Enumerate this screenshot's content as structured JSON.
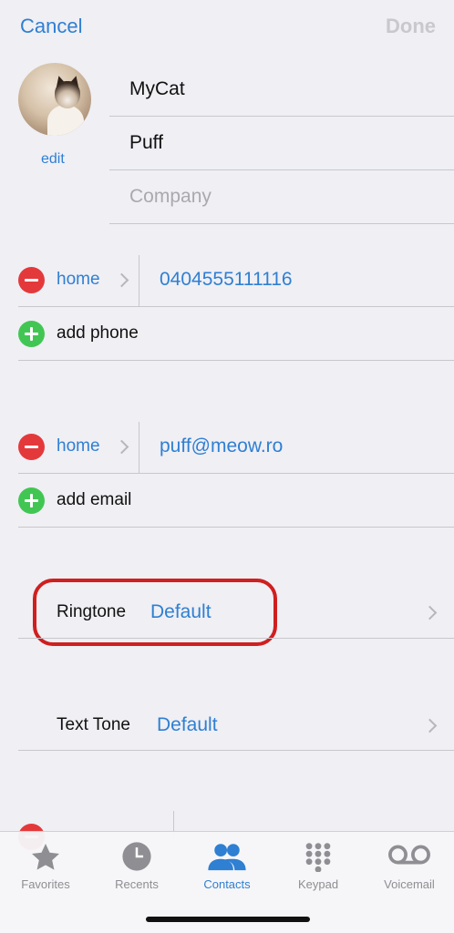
{
  "nav": {
    "cancel": "Cancel",
    "done": "Done"
  },
  "avatar": {
    "edit": "edit"
  },
  "name": {
    "first": "MyCat",
    "last": "Puff",
    "company_placeholder": "Company"
  },
  "phone": {
    "label": "home",
    "value": "0404555111116",
    "add": "add phone"
  },
  "email": {
    "label": "home",
    "value": "puff@meow.ro",
    "add": "add email"
  },
  "ringtone": {
    "label": "Ringtone",
    "value": "Default"
  },
  "texttone": {
    "label": "Text Tone",
    "value": "Default"
  },
  "tabs": [
    {
      "label": "Favorites",
      "icon": "star-icon"
    },
    {
      "label": "Recents",
      "icon": "clock-icon"
    },
    {
      "label": "Contacts",
      "icon": "contacts-icon"
    },
    {
      "label": "Keypad",
      "icon": "keypad-icon"
    },
    {
      "label": "Voicemail",
      "icon": "voicemail-icon"
    }
  ],
  "colors": {
    "accent": "#2f7fd2",
    "delete": "#e4393b",
    "add": "#42c653",
    "highlight": "#cf1f1f"
  }
}
